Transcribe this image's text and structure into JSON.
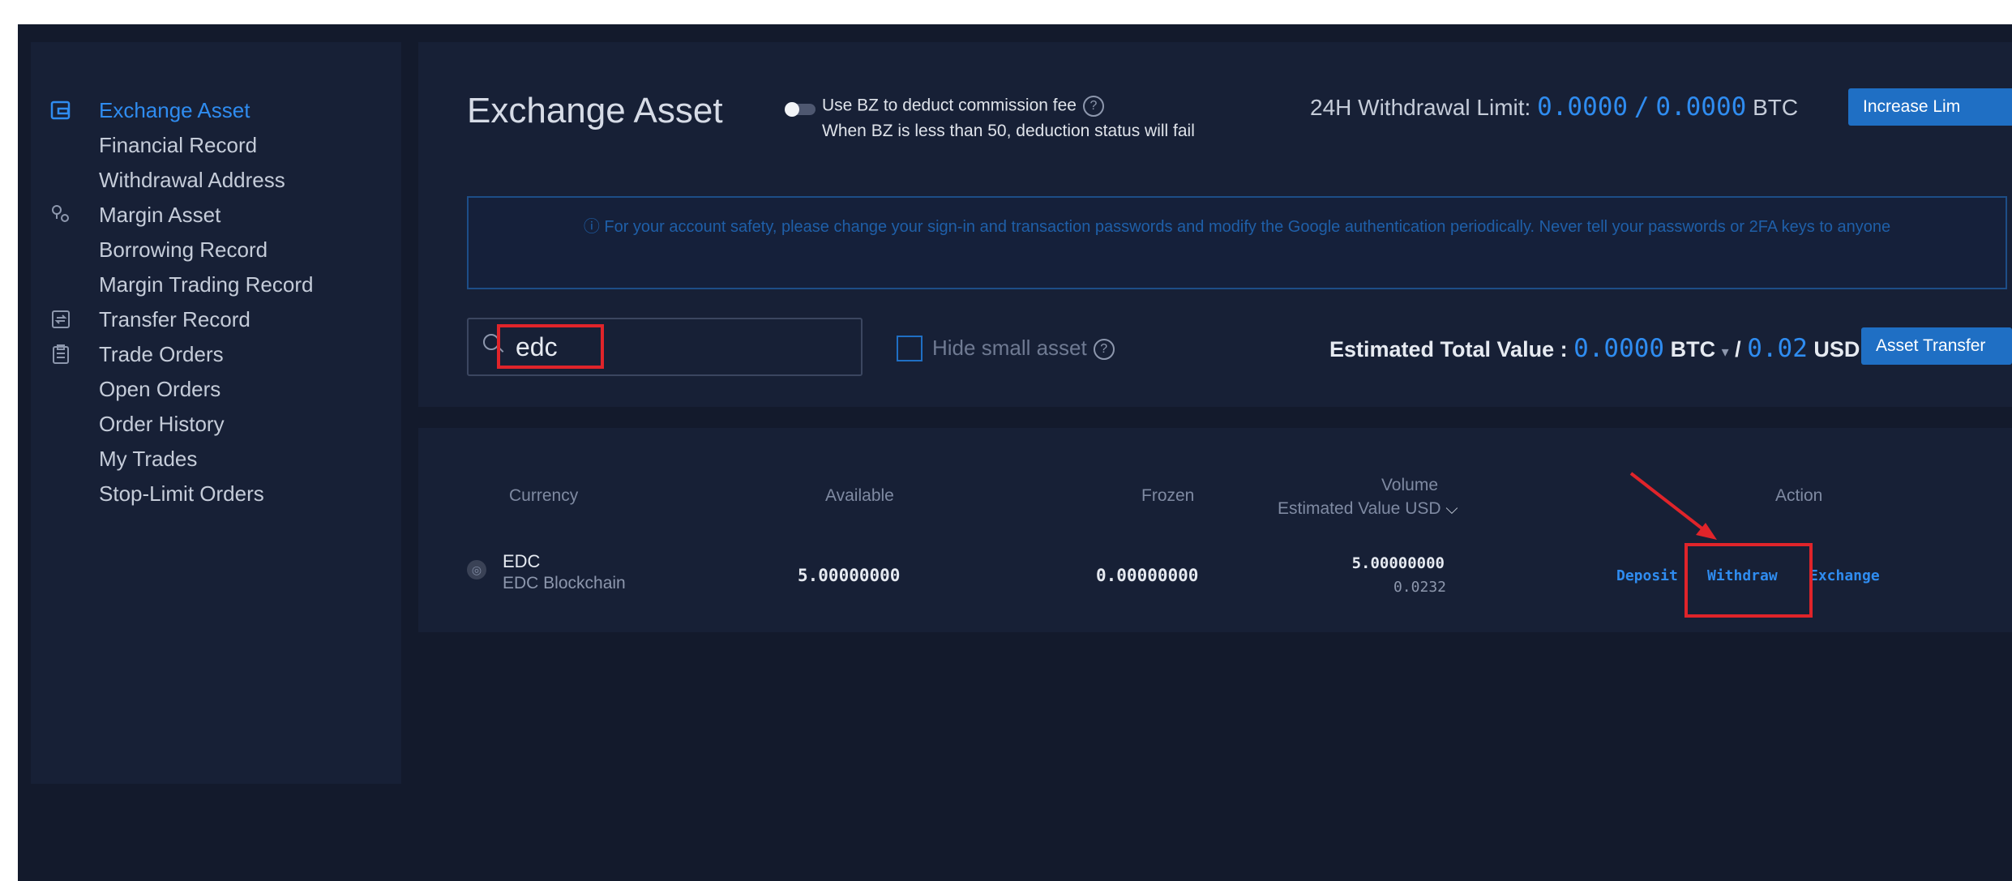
{
  "sidebar": {
    "items": [
      {
        "label": "Exchange Asset",
        "icon": "wallet-icon",
        "active": true
      },
      {
        "label": "Financial Record"
      },
      {
        "label": "Withdrawal Address"
      },
      {
        "label": "Margin Asset",
        "icon": "margin-icon"
      },
      {
        "label": "Borrowing Record"
      },
      {
        "label": "Margin Trading Record"
      },
      {
        "label": "Transfer Record",
        "icon": "transfer-icon"
      },
      {
        "label": "Trade Orders",
        "icon": "clipboard-icon"
      },
      {
        "label": "Open Orders"
      },
      {
        "label": "Order History"
      },
      {
        "label": "My Trades"
      },
      {
        "label": "Stop-Limit Orders"
      }
    ]
  },
  "header": {
    "title": "Exchange Asset",
    "fee_line1": "Use BZ to deduct commission fee",
    "fee_line2": "When BZ is less than 50, deduction status will fail",
    "limit_label": "24H Withdrawal Limit:",
    "limit_used": "0.0000",
    "limit_sep": "/",
    "limit_total": "0.0000",
    "limit_unit": "BTC",
    "increase_button": "Increase Lim"
  },
  "notice": {
    "text": "ⓘ  For your account safety, please change your sign-in and transaction passwords and modify the Google authentication periodically. Never tell your passwords or 2FA keys to anyone"
  },
  "filters": {
    "search_value": "edc",
    "hide_small_label": "Hide small asset",
    "estimated_label": "Estimated Total Value :",
    "btc_value": "0.0000",
    "btc_unit": "BTC",
    "usd_sep": "/",
    "usd_value": "0.02",
    "usd_unit": "USD",
    "transfer_button": "Asset Transfer"
  },
  "table": {
    "headers": {
      "currency": "Currency",
      "available": "Available",
      "frozen": "Frozen",
      "volume": "Volume",
      "estimated": "Estimated Value USD",
      "action": "Action"
    },
    "rows": [
      {
        "symbol": "EDC",
        "name": "EDC Blockchain",
        "available": "5.00000000",
        "frozen": "0.00000000",
        "volume": "5.00000000",
        "usd": "0.0232",
        "actions": [
          "Deposit",
          "Withdraw",
          "Exchange"
        ]
      }
    ]
  },
  "colors": {
    "background": "#131a2c",
    "panel": "#172036",
    "accent": "#2f8cf0",
    "highlight": "#e0242a"
  }
}
